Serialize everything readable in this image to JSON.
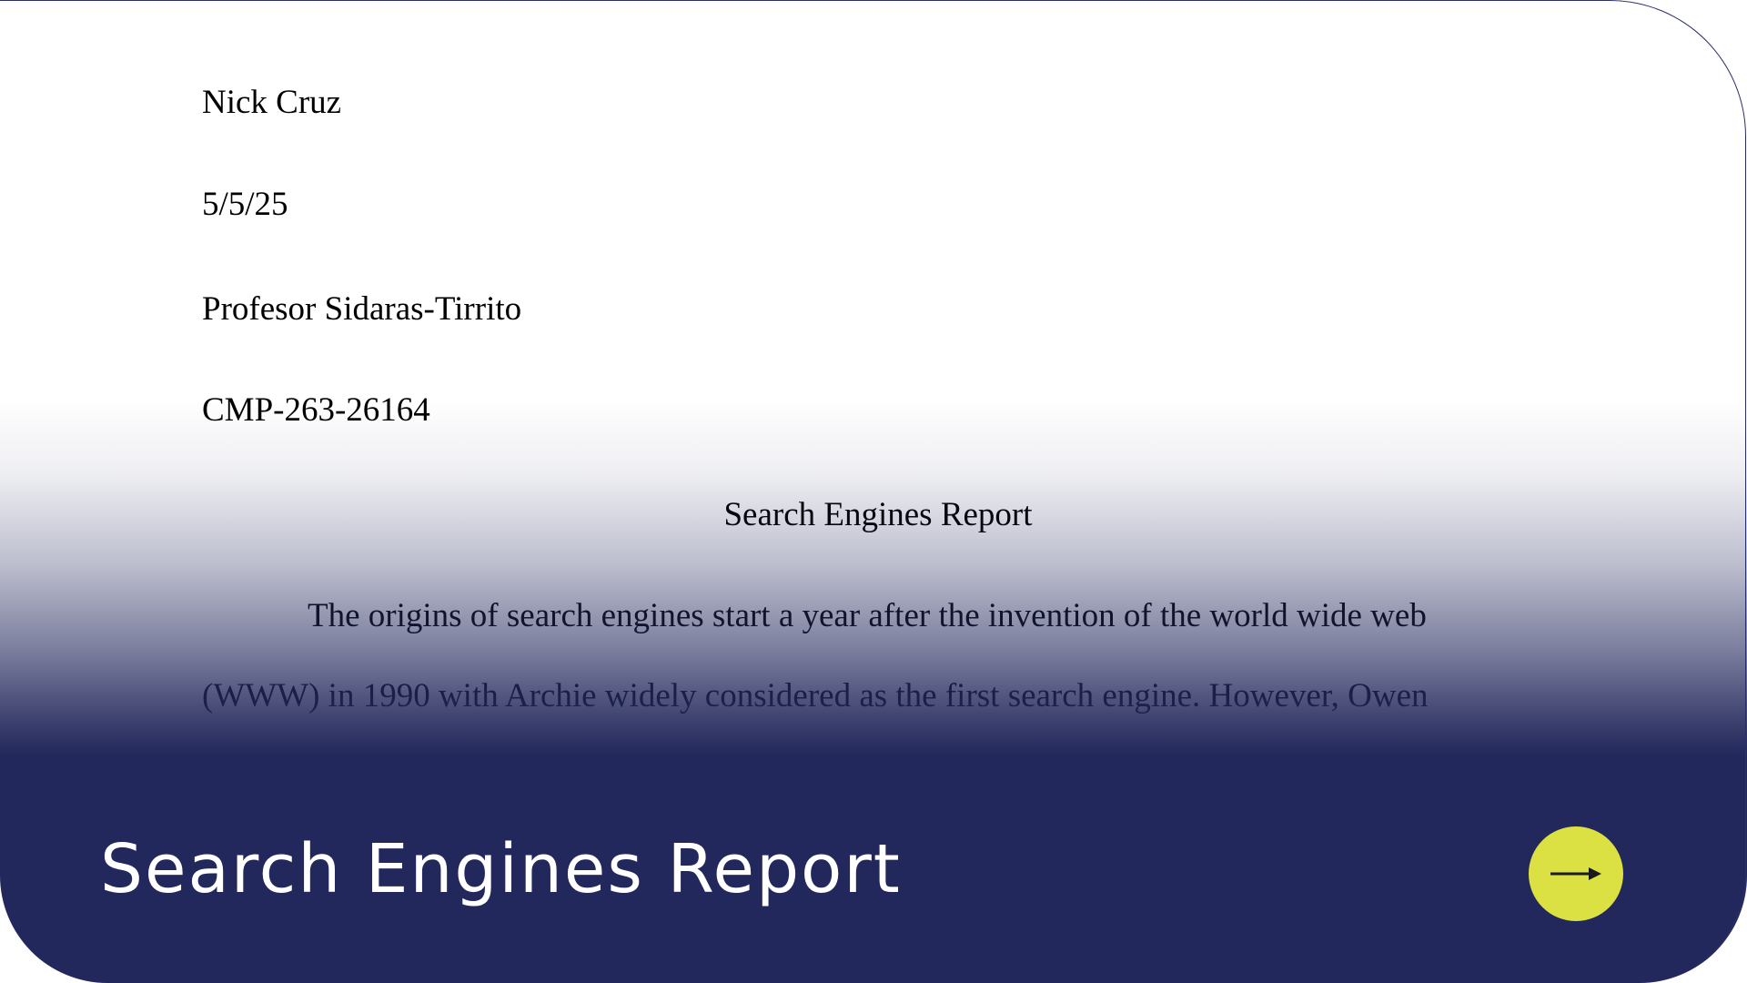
{
  "document": {
    "author": "Nick Cruz",
    "date": "5/5/25",
    "professor": "Profesor Sidaras-Tirrito",
    "course": "CMP-263-26164",
    "title": "Search Engines Report",
    "paragraph_line_1": "The origins of search engines start a year after the invention of the world wide web",
    "paragraph_line_2": "(WWW) in 1990 with Archie widely considered as the first search engine. However, Owen"
  },
  "card": {
    "title": "Search Engines Report",
    "action_icon": "arrow-right-icon",
    "accent_color": "#dbe142",
    "overlay_color": "#23285c"
  }
}
